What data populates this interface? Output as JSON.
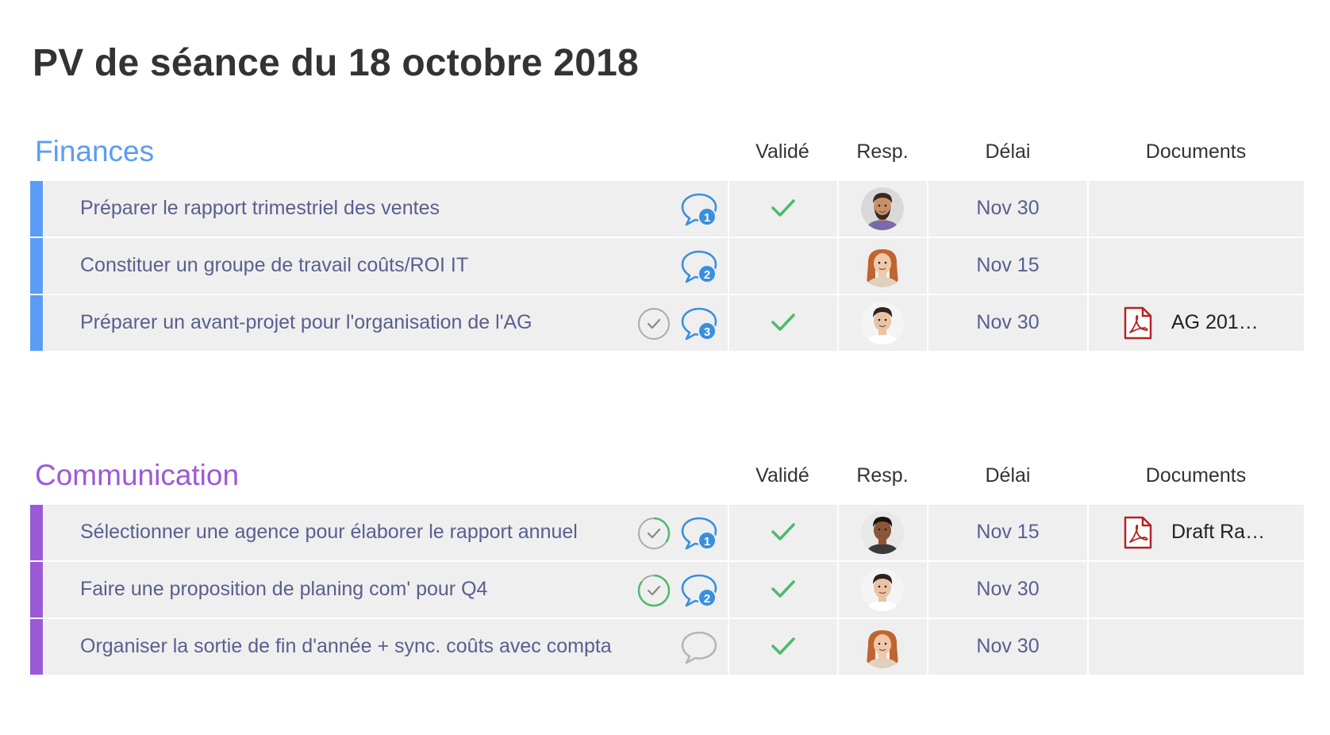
{
  "page": {
    "title": "PV de séance du 18 octobre 2018"
  },
  "columns": {
    "valide": "Validé",
    "resp": "Resp.",
    "delai": "Délai",
    "documents": "Documents"
  },
  "groups": [
    {
      "title": "Finances",
      "color": "#5b9cf6",
      "items": [
        {
          "name": "Préparer le rapport trimestriel des ventes",
          "comments": "1",
          "validated": true,
          "resp_avatar": "avatar-man-beard",
          "delai": "Nov 30",
          "progress": null,
          "document": ""
        },
        {
          "name": "Constituer un groupe de travail  coûts/ROI IT",
          "comments": "2",
          "validated": false,
          "resp_avatar": "avatar-woman-red-hair",
          "delai": "Nov 15",
          "progress": null,
          "document": ""
        },
        {
          "name": "Préparer un avant-projet pour l'organisation de l'AG",
          "comments": "3",
          "validated": true,
          "resp_avatar": "avatar-man-dark-hair",
          "delai": "Nov 30",
          "progress": 0,
          "document": "AG 201…"
        }
      ]
    },
    {
      "title": "Communication",
      "color": "#9b59d6",
      "items": [
        {
          "name": "Sélectionner une agence pour élaborer le rapport annuel",
          "comments": "1",
          "validated": true,
          "resp_avatar": "avatar-man-curly-hair",
          "delai": "Nov 15",
          "progress": 0.35,
          "document": "Draft Ra…"
        },
        {
          "name": "Faire une proposition de planing com' pour Q4",
          "comments": "2",
          "validated": true,
          "resp_avatar": "avatar-man-dark-hair",
          "delai": "Nov 30",
          "progress": 0.85,
          "document": ""
        },
        {
          "name": "Organiser la sortie de fin d'année + sync. coûts avec compta",
          "comments": "",
          "validated": true,
          "resp_avatar": "avatar-woman-red-hair",
          "delai": "Nov 30",
          "progress": null,
          "document": ""
        }
      ]
    }
  ],
  "colors": {
    "accent_blue": "#3a8fdd",
    "check_green": "#4cbb6c",
    "pdf_red": "#b52323",
    "row_bg": "#efefef",
    "text": "#5a5e8e"
  }
}
